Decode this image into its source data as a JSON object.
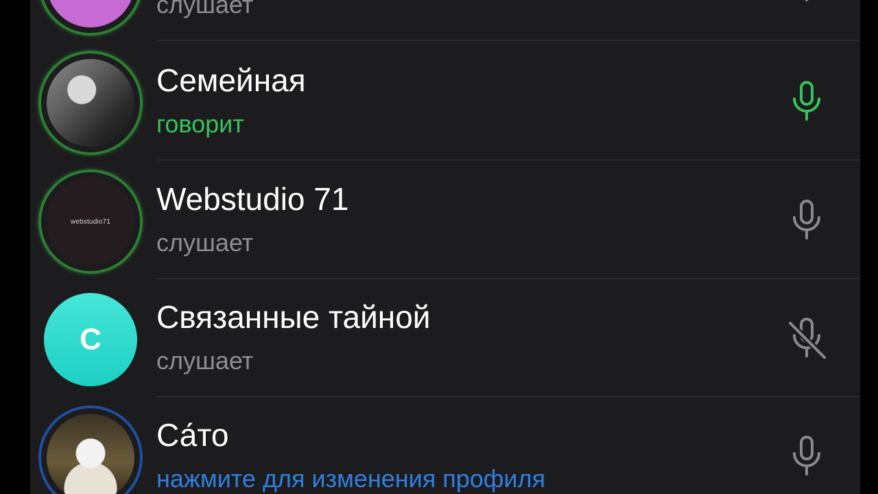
{
  "colors": {
    "background": "#1c1c1e",
    "speaking": "#35c45a",
    "listening": "#8e8e93",
    "link": "#2f7fe0",
    "mic_default": "#8a8a8e"
  },
  "participants": [
    {
      "name": "",
      "status": "слушает",
      "status_type": "listening",
      "mic": "mic-icon"
    },
    {
      "name": "Семейная",
      "status": "говорит",
      "status_type": "speaking",
      "mic": "mic-icon"
    },
    {
      "name": "Webstudio 71",
      "status": "слушает",
      "status_type": "listening",
      "mic": "mic-icon",
      "avatar_text": "webstudio71"
    },
    {
      "name": "Связанные тайной",
      "status": "слушает",
      "status_type": "listening",
      "mic": "mic-muted-icon",
      "avatar_text": "С"
    },
    {
      "name": "Са́то",
      "status": "нажмите для изменения профиля",
      "status_type": "link",
      "mic": "mic-icon"
    }
  ]
}
